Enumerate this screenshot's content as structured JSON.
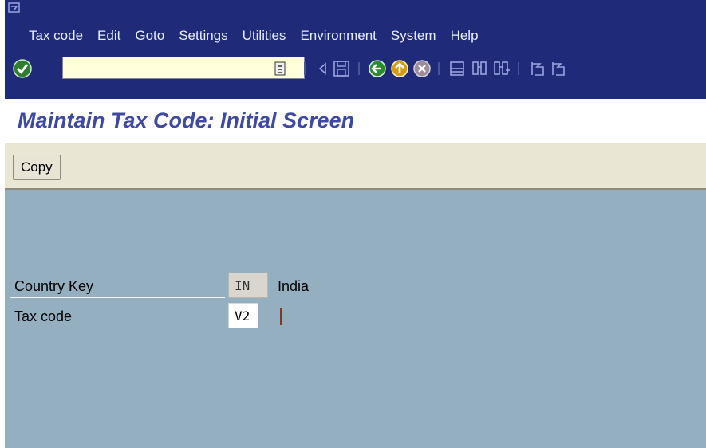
{
  "menubar": {
    "items": [
      "Tax code",
      "Edit",
      "Goto",
      "Settings",
      "Utilities",
      "Environment",
      "System",
      "Help"
    ]
  },
  "toolbar": {
    "command_field_value": "",
    "icons": [
      "enter-icon",
      "command-list-icon",
      "back-arrow-icon",
      "save-icon",
      "back-icon",
      "exit-icon",
      "cancel-icon",
      "print-icon",
      "find-icon",
      "find-next-icon",
      "first-page-icon",
      "previous-page-icon"
    ]
  },
  "title": "Maintain Tax Code: Initial Screen",
  "app_toolbar": {
    "copy_label": "Copy"
  },
  "form": {
    "country_key_label": "Country Key",
    "country_key_value": "IN",
    "country_name": "India",
    "tax_code_label": "Tax code",
    "tax_code_value": "V2"
  },
  "colors": {
    "menubar_bg": "#1f2a78",
    "title_color": "#3d4aa0",
    "workarea_bg": "#94afc0",
    "app_toolbar_bg": "#e9e6d3"
  }
}
